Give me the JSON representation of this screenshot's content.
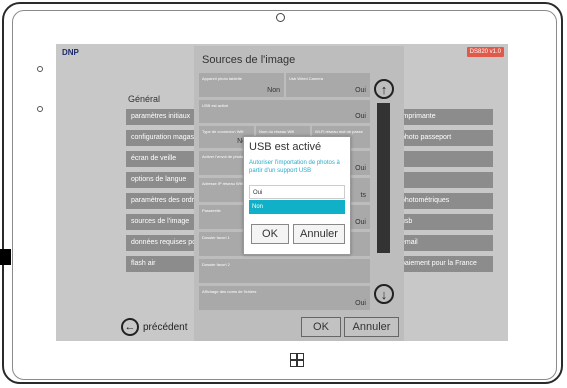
{
  "header": {
    "brand": "DNP",
    "badge": "DS820 v1.0"
  },
  "general": {
    "title": "Général",
    "items": [
      "paramètres initiaux",
      "configuration magasin",
      "écran de veille",
      "options de langue",
      "paramètres des ordres",
      "sources de l'image",
      "données requises pour",
      "flash air"
    ],
    "right_items": [
      "imprimante",
      "photo passeport",
      "",
      "",
      "photométriques",
      "usb",
      "email",
      "paiement pour la France"
    ]
  },
  "back_button": {
    "label": "précédent"
  },
  "panel": {
    "title": "Sources de l'image",
    "fields": [
      {
        "label": "Appareil photo tablette",
        "value": "Non"
      },
      {
        "label": "Usb Wired Camera",
        "value": "Oui"
      },
      {
        "label": "USB est activé",
        "value": "Oui"
      },
      {
        "label": "Type de connexion Wifi",
        "value": "Non"
      },
      {
        "label": "Nom du réseau Wifi",
        "value": ""
      },
      {
        "label": "Wi-Fi réseau mot de passe",
        "value": ""
      },
      {
        "label": "Activer l'envoi de photos",
        "value": "Oui"
      },
      {
        "label": "Adresse IP réseau Wifi",
        "value": "ts"
      },
      {
        "label": "Passerelle",
        "value": "Oui"
      },
      {
        "label": "Dossier favori 1",
        "value": ""
      },
      {
        "label": "Dossier favori 2",
        "value": ""
      },
      {
        "label": "Affichage des noms de fichiers",
        "value": "Oui"
      }
    ],
    "ok": "OK",
    "cancel": "Annuler"
  },
  "dialog": {
    "title": "USB est activé",
    "message": "Autoriser l'importation de photos à partir d'un support USB",
    "options": [
      "Oui",
      "Non"
    ],
    "selected": "Non",
    "ok": "OK",
    "cancel": "Annuler"
  },
  "colors": {
    "accent": "#10b0c8",
    "badge": "#e05a4a",
    "menu": "#8c8c8c"
  },
  "icons": {
    "scroll_up": "arrow-up-circle-icon",
    "scroll_down": "arrow-down-circle-icon",
    "back": "arrow-left-circle-icon",
    "windows": "windows-logo-icon"
  }
}
